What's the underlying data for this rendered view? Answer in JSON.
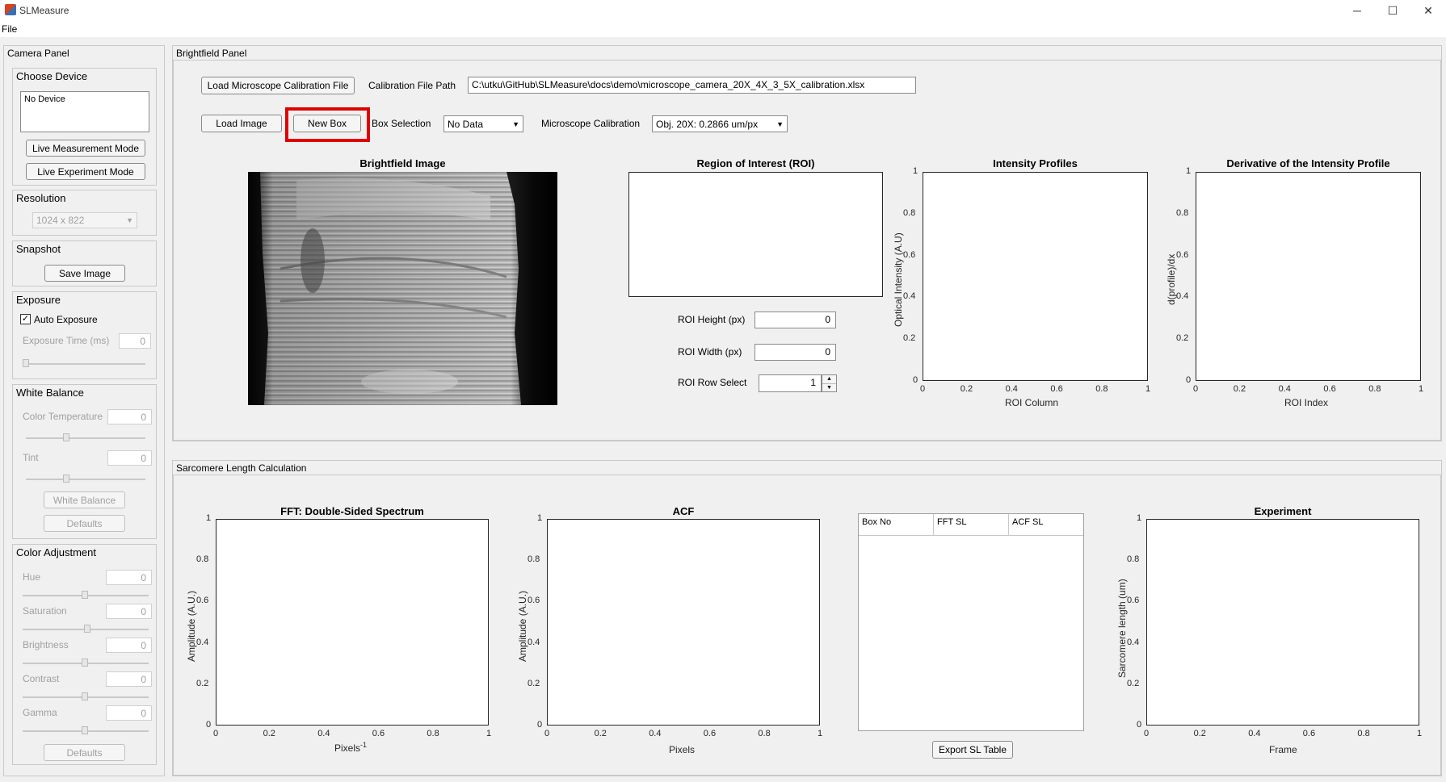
{
  "window": {
    "title": "SLMeasure",
    "minimize": "─",
    "maximize": "☐",
    "close": "✕"
  },
  "menu": {
    "file": "File"
  },
  "camera_panel": {
    "title": "Camera Panel",
    "choose_device": {
      "title": "Choose Device",
      "list_item": "No Device",
      "live_measurement": "Live Measurement Mode",
      "live_experiment": "Live Experiment Mode"
    },
    "resolution": {
      "title": "Resolution",
      "value": "1024 x 822"
    },
    "snapshot": {
      "title": "Snapshot",
      "save_image": "Save Image"
    },
    "exposure": {
      "title": "Exposure",
      "auto_label": "Auto Exposure",
      "auto_checked": true,
      "time_label": "Exposure Time (ms)",
      "time_value": "0"
    },
    "white_balance": {
      "title": "White Balance",
      "color_temp_label": "Color Temperature",
      "color_temp_value": "0",
      "tint_label": "Tint",
      "tint_value": "0",
      "wb_button": "White Balance",
      "defaults": "Defaults"
    },
    "color_adjustment": {
      "title": "Color Adjustment",
      "hue_label": "Hue",
      "hue_value": "0",
      "saturation_label": "Saturation",
      "saturation_value": "0",
      "brightness_label": "Brightness",
      "brightness_value": "0",
      "contrast_label": "Contrast",
      "contrast_value": "0",
      "gamma_label": "Gamma",
      "gamma_value": "0",
      "defaults": "Defaults"
    }
  },
  "brightfield": {
    "title": "Brightfield Panel",
    "load_calibration": "Load Microscope Calibration File",
    "calibration_path_label": "Calibration File Path",
    "calibration_path": "C:\\utku\\GitHub\\SLMeasure\\docs\\demo\\microscope_camera_20X_4X_3_5X_calibration.xlsx",
    "load_image": "Load Image",
    "new_box": "New Box",
    "box_selection_label": "Box Selection",
    "box_selection_value": "No Data",
    "microscope_calibration_label": "Microscope Calibration",
    "microscope_calibration_value": "Obj. 20X: 0.2866 um/px",
    "image_title": "Brightfield Image",
    "roi_title": "Region of Interest (ROI)",
    "roi_height_label": "ROI Height (px)",
    "roi_height_value": "0",
    "roi_width_label": "ROI Width (px)",
    "roi_width_value": "0",
    "roi_row_label": "ROI Row Select",
    "roi_row_value": "1",
    "intensity_title": "Intensity Profiles",
    "intensity_ylabel": "Optical Intensity (A.U)",
    "intensity_xlabel": "ROI Column",
    "derivative_title": "Derivative of the Intensity Profile",
    "derivative_ylabel": "d(profile)/dx",
    "derivative_xlabel": "ROI Index"
  },
  "sarcomere": {
    "title": "Sarcomere Length Calculation",
    "fft_title": "FFT: Double-Sided Spectrum",
    "fft_ylabel": "Amplitude (A.U.)",
    "fft_xlabel": "Pixels",
    "fft_xlabel_sup": "-1",
    "acf_title": "ACF",
    "acf_ylabel": "Amplitude (A.U.)",
    "acf_xlabel": "Pixels",
    "table_headers": [
      "Box No",
      "FFT SL",
      "ACF SL"
    ],
    "export": "Export SL Table",
    "exp_title": "Experiment",
    "exp_ylabel": "Sarcomere length (um)",
    "exp_xlabel": "Frame"
  },
  "ticks": [
    "0",
    "0.2",
    "0.4",
    "0.6",
    "0.8",
    "1"
  ],
  "colors": {
    "highlight": "#e00000",
    "background": "#f0f0f0"
  },
  "icons": {
    "dropdown": "triangle-down-icon",
    "spinner_up": "triangle-up-icon",
    "spinner_down": "triangle-down-icon",
    "check": "check-icon"
  }
}
